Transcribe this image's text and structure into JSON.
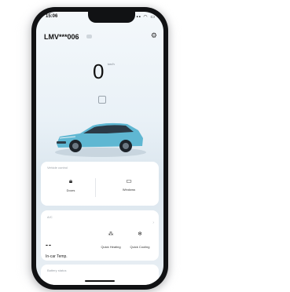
{
  "status_bar": {
    "time": "15:06",
    "icons": "▪▪ ◠ ▭"
  },
  "header": {
    "vin": "LMV***006",
    "settings_icon": "gear-icon"
  },
  "speed": {
    "value": "0",
    "unit": "km/h"
  },
  "vehicle_controls": {
    "title": "Vehicle control",
    "items": [
      {
        "label": "Doors",
        "icon": "lock-icon"
      },
      {
        "label": "Windows",
        "icon": "window-icon"
      }
    ]
  },
  "ac": {
    "title": "A/C",
    "temp_value": "--",
    "temp_label": "In-car Temp.",
    "actions": [
      {
        "label": "Quick Heating",
        "icon": "heat-icon"
      },
      {
        "label": "Quick Cooling",
        "icon": "snowflake-icon"
      }
    ]
  },
  "next_panel": {
    "title": "Battery status"
  }
}
